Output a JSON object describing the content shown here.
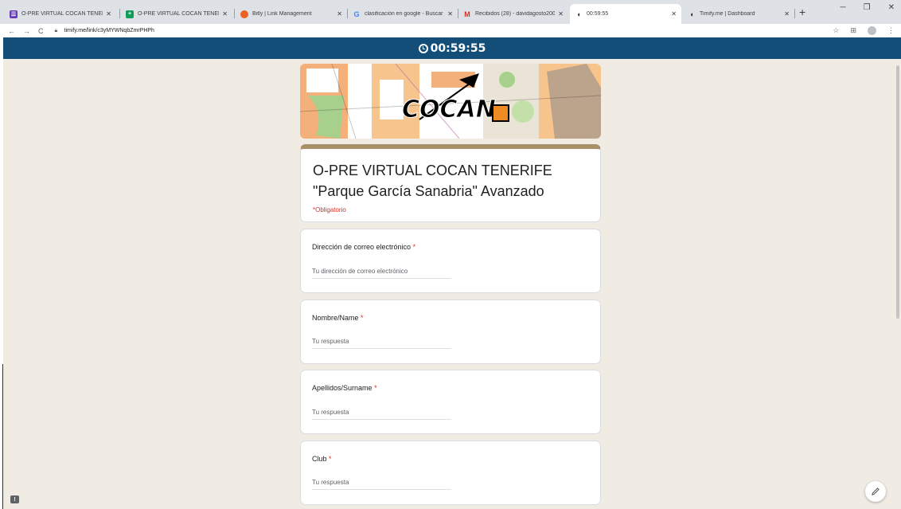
{
  "browser": {
    "tabs": [
      {
        "title": "O-PRE VIRTUAL COCAN TENERIFE",
        "icon": "google-forms-icon",
        "color": "#673ab7"
      },
      {
        "title": "O-PRE VIRTUAL COCAN TENERIFE",
        "icon": "google-sheets-icon",
        "color": "#0f9d58"
      },
      {
        "title": "Bitly | Link Management",
        "icon": "bitly-icon",
        "color": "#ee6123"
      },
      {
        "title": "clasificación en google - Buscar",
        "icon": "google-icon",
        "color": "#4285f4"
      },
      {
        "title": "Recibidos (28) - davidagosto200",
        "icon": "gmail-icon",
        "color": "#d93025"
      },
      {
        "title": "00:59:55",
        "icon": "timify-icon",
        "color": "#202124",
        "active": true
      },
      {
        "title": "Timify.me | Dashboard",
        "icon": "timify-icon",
        "color": "#202124"
      }
    ],
    "url": "timify.me/link/c3yMYWNqbZmrPHPh"
  },
  "timer": {
    "display": "00:59:55",
    "bar_color": "#124e78"
  },
  "form": {
    "title_line1": "O-PRE VIRTUAL COCAN TENERIFE",
    "title_line2": "\"Parque García Sanabria\" Avanzado",
    "required_note": "*Obligatorio",
    "questions": [
      {
        "label": "Dirección de correo electrónico",
        "required_mark": "*",
        "placeholder": "Tu dirección de correo electrónico"
      },
      {
        "label": "Nombre/Name",
        "required_mark": "*",
        "placeholder": "Tu respuesta"
      },
      {
        "label": "Apellidos/Surname",
        "required_mark": "*",
        "placeholder": "Tu respuesta"
      },
      {
        "label": "Club",
        "required_mark": "*",
        "placeholder": "Tu respuesta"
      }
    ],
    "accent_color": "#a89068",
    "banner_logo_text": "COCAN"
  }
}
